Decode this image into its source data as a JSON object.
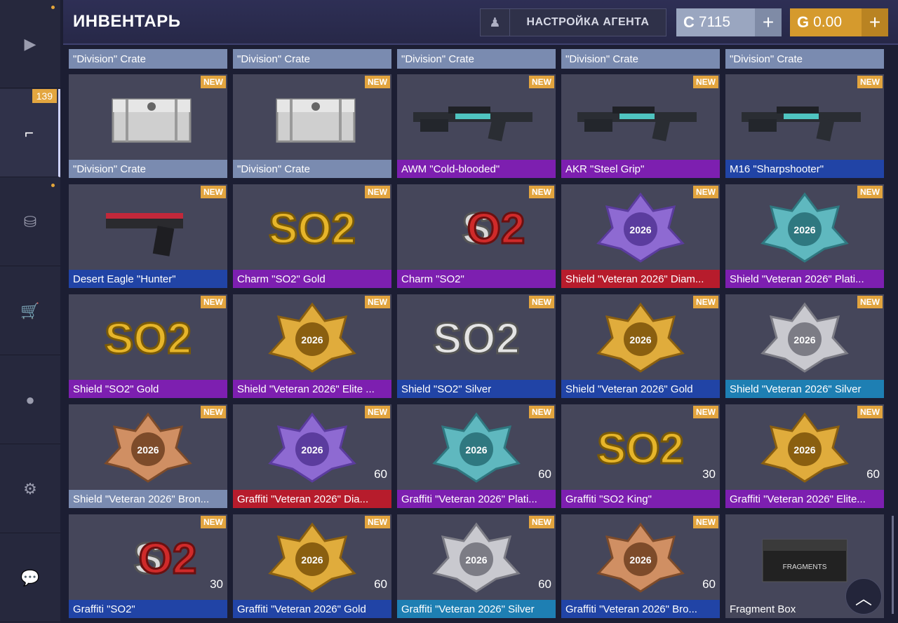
{
  "header": {
    "title": "ИНВЕНТАРЬ",
    "agent_button": "НАСТРОЙКА АГЕНТА",
    "silver_symbol": "C",
    "silver_amount": "7115",
    "gold_symbol": "G",
    "gold_amount": "0.00",
    "plus": "+"
  },
  "sidebar": {
    "badge": "139",
    "items": [
      {
        "icon": "play-icon",
        "glyph": "▶"
      },
      {
        "icon": "pistol-icon",
        "glyph": "⌐"
      },
      {
        "icon": "coins-icon",
        "glyph": "⛁"
      },
      {
        "icon": "cart-icon",
        "glyph": "🛒"
      },
      {
        "icon": "agent-head-icon",
        "glyph": "●"
      },
      {
        "icon": "gear-icon",
        "glyph": "⚙"
      },
      {
        "icon": "chat-icon",
        "glyph": "💬"
      }
    ]
  },
  "new_label": "NEW",
  "top_row": [
    "\"Division\" Crate",
    "\"Division\" Crate",
    "\"Division\" Crate",
    "\"Division\" Crate",
    "\"Division\" Crate"
  ],
  "items": [
    {
      "label": "\"Division\" Crate",
      "rarity": "#7a8bb0",
      "art": "crate",
      "count": ""
    },
    {
      "label": "\"Division\" Crate",
      "rarity": "#7a8bb0",
      "art": "crate",
      "count": ""
    },
    {
      "label": "AWM \"Cold-blooded\"",
      "rarity": "#7d1fb0",
      "art": "rifle",
      "count": ""
    },
    {
      "label": "AKR \"Steel Grip\"",
      "rarity": "#7d1fb0",
      "art": "rifle",
      "count": ""
    },
    {
      "label": "M16 \"Sharpshooter\"",
      "rarity": "#2144a6",
      "art": "rifle",
      "count": ""
    },
    {
      "label": "Desert Eagle \"Hunter\"",
      "rarity": "#2144a6",
      "art": "pistol",
      "count": ""
    },
    {
      "label": "Charm \"SO2\" Gold",
      "rarity": "#7d1fb0",
      "art": "so2-gold",
      "count": ""
    },
    {
      "label": "Charm \"SO2\"",
      "rarity": "#7d1fb0",
      "art": "so2-red",
      "count": ""
    },
    {
      "label": "Shield \"Veteran 2026\" Diam...",
      "rarity": "#b71c2c",
      "art": "badge-purple",
      "count": ""
    },
    {
      "label": "Shield \"Veteran 2026\" Plati...",
      "rarity": "#7d1fb0",
      "art": "badge-teal",
      "count": ""
    },
    {
      "label": "Shield \"SO2\" Gold",
      "rarity": "#7d1fb0",
      "art": "so2-gold",
      "count": ""
    },
    {
      "label": "Shield \"Veteran 2026\" Elite ...",
      "rarity": "#7d1fb0",
      "art": "badge-gold",
      "count": ""
    },
    {
      "label": "Shield \"SO2\" Silver",
      "rarity": "#2144a6",
      "art": "so2-silver",
      "count": ""
    },
    {
      "label": "Shield \"Veteran 2026\" Gold",
      "rarity": "#2144a6",
      "art": "badge-gold",
      "count": ""
    },
    {
      "label": "Shield \"Veteran 2026\" Silver",
      "rarity": "#1e7fb3",
      "art": "badge-silver",
      "count": ""
    },
    {
      "label": "Shield \"Veteran 2026\" Bron...",
      "rarity": "#7a8bb0",
      "art": "badge-bronze",
      "count": ""
    },
    {
      "label": "Graffiti \"Veteran 2026\" Dia...",
      "rarity": "#b71c2c",
      "art": "badge-purple",
      "count": "60"
    },
    {
      "label": "Graffiti \"Veteran 2026\" Plati...",
      "rarity": "#7d1fb0",
      "art": "badge-teal",
      "count": "60"
    },
    {
      "label": "Graffiti \"SO2 King\"",
      "rarity": "#7d1fb0",
      "art": "so2-gold",
      "count": "30"
    },
    {
      "label": "Graffiti \"Veteran 2026\" Elite...",
      "rarity": "#7d1fb0",
      "art": "badge-gold",
      "count": "60"
    },
    {
      "label": "Graffiti \"SO2\"",
      "rarity": "#2144a6",
      "art": "so2-red",
      "count": "30"
    },
    {
      "label": "Graffiti \"Veteran 2026\" Gold",
      "rarity": "#2144a6",
      "art": "badge-gold",
      "count": "60"
    },
    {
      "label": "Graffiti \"Veteran 2026\" Silver",
      "rarity": "#1e7fb3",
      "art": "badge-silver",
      "count": "60"
    },
    {
      "label": "Graffiti \"Veteran 2026\" Bro...",
      "rarity": "#2144a6",
      "art": "badge-bronze",
      "count": "60"
    },
    {
      "label": "Fragment Box",
      "rarity": "#45465a",
      "art": "box",
      "count": ""
    }
  ],
  "scroll_top_glyph": "︿"
}
